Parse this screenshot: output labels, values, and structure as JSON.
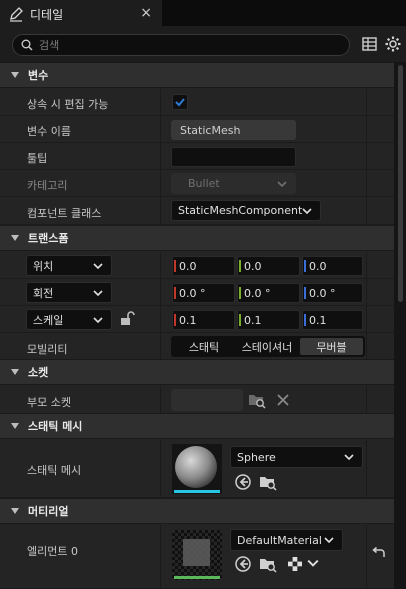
{
  "tab": {
    "title": "디테일",
    "icon": "pencil-icon",
    "close": "×"
  },
  "search": {
    "placeholder": "검색"
  },
  "sections": {
    "variables": "변수",
    "transform": "트랜스폼",
    "sockets": "소켓",
    "static_mesh": "스태틱 메시",
    "materials": "머티리얼"
  },
  "variables": {
    "editable_label": "상속 시 편집 가능",
    "editable_checked": true,
    "name_label": "변수 이름",
    "name_value": "StaticMesh",
    "tooltip_label": "툴팁",
    "tooltip_value": "",
    "category_label": "카테고리",
    "category_value": "Bullet",
    "component_class_label": "컴포넌트 클래스",
    "component_class_value": "StaticMeshComponent"
  },
  "transform": {
    "location_label": "위치",
    "location": [
      "0.0",
      "0.0",
      "0.0"
    ],
    "rotation_label": "회전",
    "rotation": [
      "0.0 °",
      "0.0 °",
      "0.0 °"
    ],
    "scale_label": "스케일",
    "scale": [
      "0.1",
      "0.1",
      "0.1"
    ],
    "mobility_label": "모빌리티",
    "mobility_options": [
      "스태틱",
      "스테이셔너",
      "무버블"
    ],
    "mobility_selected": "무버블",
    "axis_colors": [
      "#c0392b",
      "#7cae2d",
      "#3a6fd8"
    ]
  },
  "sockets": {
    "parent_socket_label": "부모 소켓",
    "parent_socket_value": ""
  },
  "static_mesh": {
    "label": "스태틱 메시",
    "value": "Sphere"
  },
  "materials": {
    "element_label": "엘리먼트 0",
    "value": "DefaultMaterial"
  },
  "colors": {
    "accent": "#2f7bd3",
    "mesh_underline": "#27c6e6",
    "material_underline": "#5cb85c"
  }
}
